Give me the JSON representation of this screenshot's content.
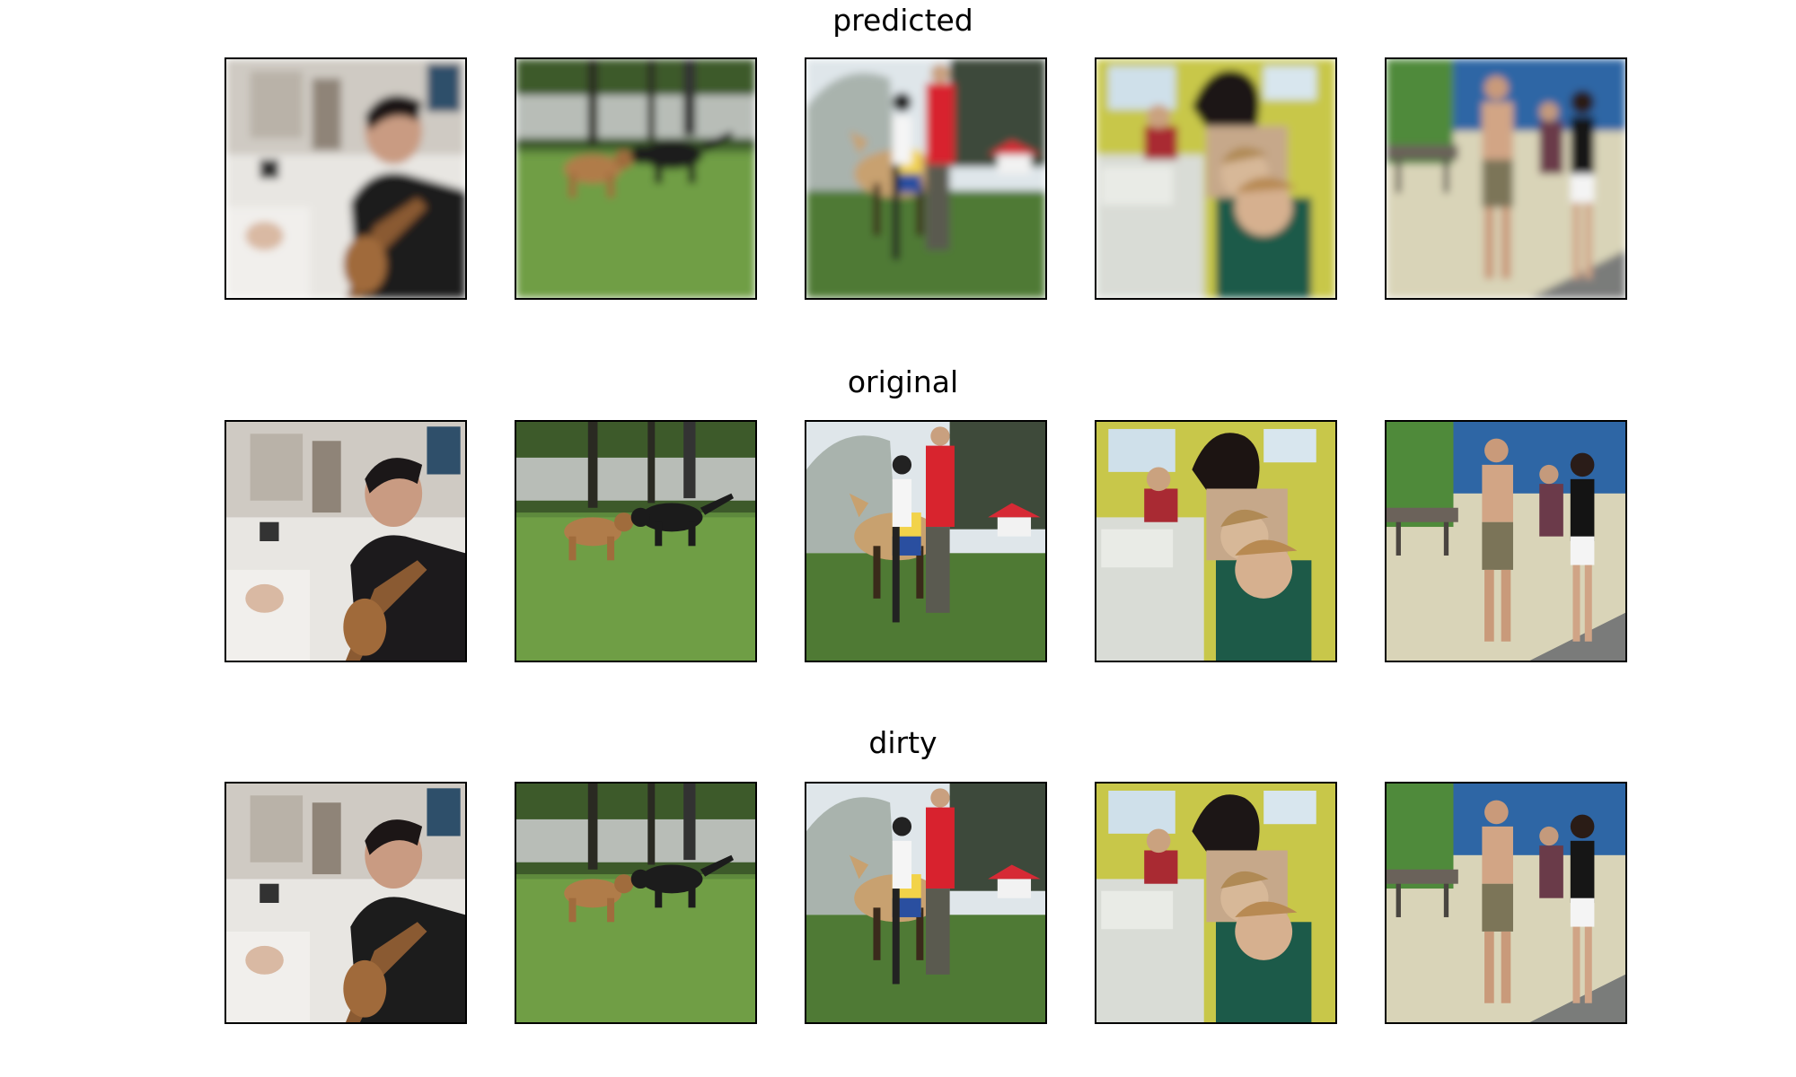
{
  "rows": [
    {
      "title": "predicted",
      "variant": "predicted",
      "panels": [
        "person-playing-guitar-in-hospital-room",
        "two-dogs-playing-on-grass",
        "person-on-horse-at-fair",
        "children-at-computer-classroom",
        "couple-walking-by-sea"
      ]
    },
    {
      "title": "original",
      "variant": "original",
      "panels": [
        "person-playing-guitar-in-hospital-room",
        "two-dogs-playing-on-grass",
        "person-on-horse-at-fair",
        "children-at-computer-classroom",
        "couple-walking-by-sea"
      ]
    },
    {
      "title": "dirty",
      "variant": "dirty",
      "panels": [
        "person-playing-guitar-in-hospital-room",
        "two-dogs-playing-on-grass",
        "person-on-horse-at-fair",
        "children-at-computer-classroom",
        "couple-walking-by-sea"
      ]
    }
  ]
}
